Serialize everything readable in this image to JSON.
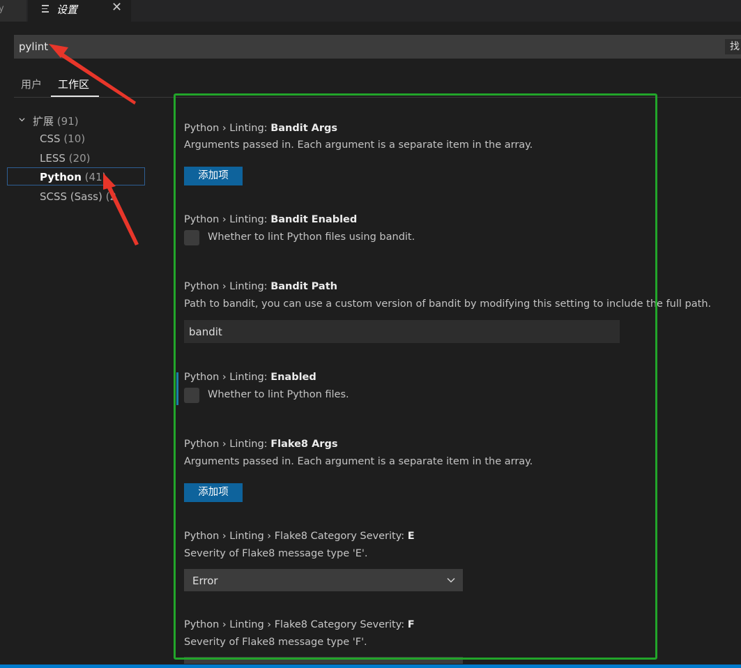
{
  "tabs": {
    "prev_label": "y",
    "active_title": "设置"
  },
  "search": {
    "value": "pylint",
    "find_button": "找"
  },
  "scope": {
    "user": "用户",
    "workspace": "工作区"
  },
  "toc": {
    "extensions": {
      "label": "扩展",
      "count": "(91)"
    },
    "items": [
      {
        "label": "CSS",
        "count": "(10)"
      },
      {
        "label": "LESS",
        "count": "(20)"
      },
      {
        "label": "Python",
        "count": "(41)"
      },
      {
        "label": "SCSS (Sass)",
        "count": "(20"
      }
    ]
  },
  "settings": [
    {
      "prefix": "Python › Linting: ",
      "name": "Bandit Args",
      "desc": "Arguments passed in. Each argument is a separate item in the array.",
      "button": "添加项"
    },
    {
      "prefix": "Python › Linting: ",
      "name": "Bandit Enabled",
      "desc": "Whether to lint Python files using bandit.",
      "checked": false
    },
    {
      "prefix": "Python › Linting: ",
      "name": "Bandit Path",
      "desc": "Path to bandit, you can use a custom version of bandit by modifying this setting to include the full path.",
      "value": "bandit"
    },
    {
      "prefix": "Python › Linting: ",
      "name": "Enabled",
      "desc": "Whether to lint Python files.",
      "checked": false
    },
    {
      "prefix": "Python › Linting: ",
      "name": "Flake8 Args",
      "desc": "Arguments passed in. Each argument is a separate item in the array.",
      "button": "添加项"
    },
    {
      "prefix": "Python › Linting › Flake8 Category Severity: ",
      "name": "E",
      "desc": "Severity of Flake8 message type 'E'.",
      "value": "Error"
    },
    {
      "prefix": "Python › Linting › Flake8 Category Severity: ",
      "name": "F",
      "desc": "Severity of Flake8 message type 'F'."
    }
  ],
  "colors": {
    "highlight_box": "#22a52a",
    "annotation_arrow": "#e8362a",
    "button": "#0e639c"
  }
}
